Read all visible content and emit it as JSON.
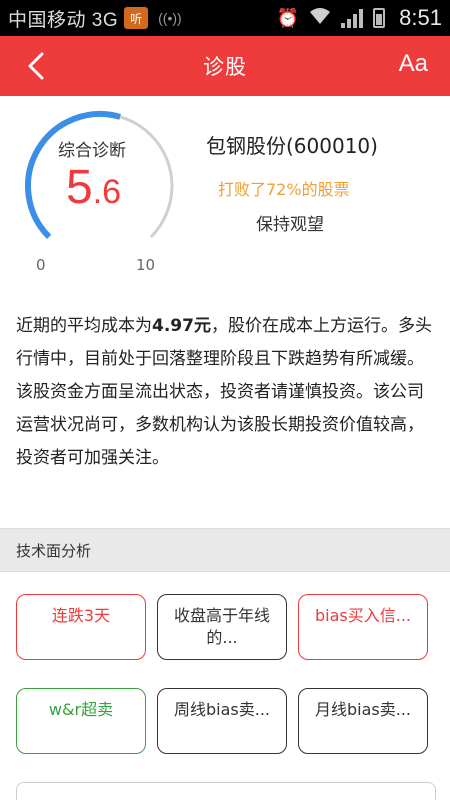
{
  "status_bar": {
    "carrier": "中国移动 3G",
    "badge": "听",
    "time": "8:51"
  },
  "header": {
    "title": "诊股",
    "font_button": "Aa"
  },
  "score": {
    "label": "综合诊断",
    "value_int": "5",
    "value_dec": ".6",
    "value": 5.6,
    "min_label": "0",
    "max_label": "10",
    "stock_name": "包钢股份(600010)",
    "beat_text": "打败了72%的股票",
    "advice": "保持观望"
  },
  "description": {
    "prefix": "近期的平均成本为",
    "highlight": "4.97元",
    "suffix": "，股价在成本上方运行。多头行情中，目前处于回落整理阶段且下跌趋势有所减缓。该股资金方面呈流出状态，投资者请谨慎投资。该公司运营状况尚可，多数机构认为该股长期投资价值较高，投资者可加强关注。"
  },
  "technical": {
    "title": "技术面分析",
    "tags": [
      {
        "label": "连跌3天",
        "tone": "red"
      },
      {
        "label": "收盘高于年线的...",
        "tone": "neutral"
      },
      {
        "label": "bias买入信...",
        "tone": "red"
      },
      {
        "label": "w&r超卖",
        "tone": "green"
      },
      {
        "label": "周线bias卖...",
        "tone": "neutral"
      },
      {
        "label": "月线bias卖...",
        "tone": "neutral"
      }
    ]
  },
  "colors": {
    "brand_red": "#ee3b3b",
    "gauge_blue": "#3c8ee6",
    "beat_orange": "#f0a030",
    "buy_green": "#3aa040"
  }
}
